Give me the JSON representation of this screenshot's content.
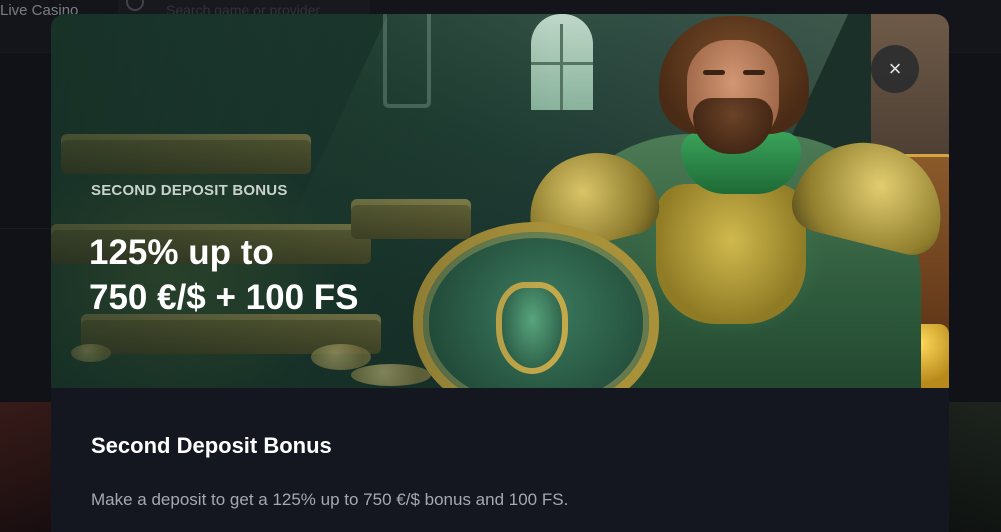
{
  "background": {
    "nav_item": "Live Casino",
    "search_placeholder": "Search game or provider"
  },
  "modal": {
    "close_symbol": "×",
    "hero": {
      "eyebrow": "SECOND DEPOSIT BONUS",
      "headline_line1": "125% up to",
      "headline_line2": "750 €/$ + 100 FS"
    },
    "title": "Second Deposit Bonus",
    "description": "Make a deposit to get a 125% up to 750 €/$ bonus and 100 FS."
  },
  "icons": {
    "close": "close-icon",
    "search": "search-icon"
  },
  "colors": {
    "page_bg": "#16181f",
    "modal_bg": "#141720",
    "hero_green": "#1c3a2f",
    "text_primary": "#ffffff",
    "text_secondary": "#a5a8b0"
  }
}
